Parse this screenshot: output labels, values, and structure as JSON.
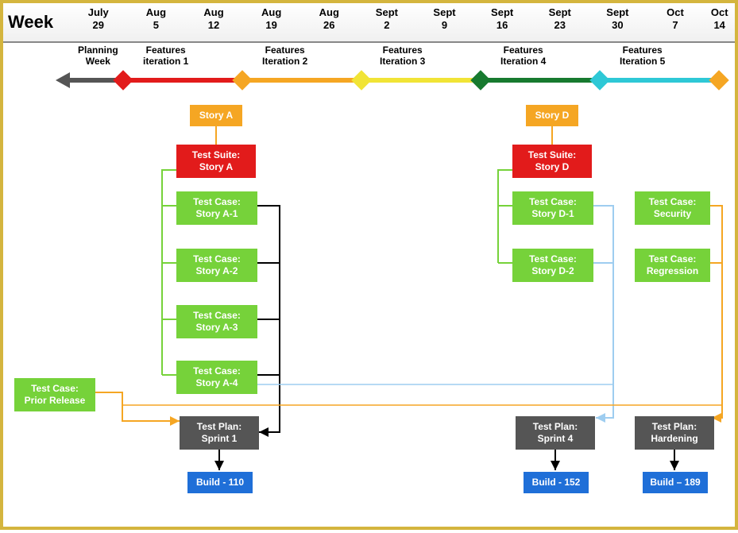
{
  "week_label": "Week",
  "dates": [
    {
      "month": "July",
      "day": "29"
    },
    {
      "month": "Aug",
      "day": "5"
    },
    {
      "month": "Aug",
      "day": "12"
    },
    {
      "month": "Aug",
      "day": "19"
    },
    {
      "month": "Aug",
      "day": "26"
    },
    {
      "month": "Sept",
      "day": "2"
    },
    {
      "month": "Sept",
      "day": "9"
    },
    {
      "month": "Sept",
      "day": "16"
    },
    {
      "month": "Sept",
      "day": "23"
    },
    {
      "month": "Sept",
      "day": "30"
    },
    {
      "month": "Oct",
      "day": "7"
    },
    {
      "month": "Oct",
      "day": "14"
    }
  ],
  "phases": [
    {
      "label": "Planning\nWeek"
    },
    {
      "label": "Features\niteration 1"
    },
    {
      "label": "Features\nIteration 2"
    },
    {
      "label": "Features\nIteration 3"
    },
    {
      "label": "Features\nIteration 4"
    },
    {
      "label": "Features\nIteration 5"
    }
  ],
  "boxes": {
    "storyA": "Story A",
    "storyD": "Story D",
    "suiteA": "Test Suite:\nStory A",
    "suiteD": "Test Suite:\nStory D",
    "caseA1": "Test Case:\nStory A-1",
    "caseA2": "Test Case:\nStory A-2",
    "caseA3": "Test Case:\nStory A-3",
    "caseA4": "Test Case:\nStory A-4",
    "caseD1": "Test Case:\nStory D-1",
    "caseD2": "Test Case:\nStory D-2",
    "caseSecurity": "Test Case:\nSecurity",
    "caseRegression": "Test Case:\nRegression",
    "casePrior": "Test Case:\nPrior Release",
    "planSprint1": "Test Plan:\nSprint 1",
    "planSprint4": "Test Plan:\nSprint 4",
    "planHardening": "Test Plan:\nHardening",
    "build110": "Build - 110",
    "build152": "Build - 152",
    "build189": "Build – 189"
  },
  "colors": {
    "planning_bar": "#555",
    "iter1_bar": "#e21b1b",
    "iter2_bar": "#f5a623",
    "iter3_bar": "#f1e436",
    "iter4_bar": "#177a2f",
    "iter5_bar": "#2ec8d6"
  }
}
